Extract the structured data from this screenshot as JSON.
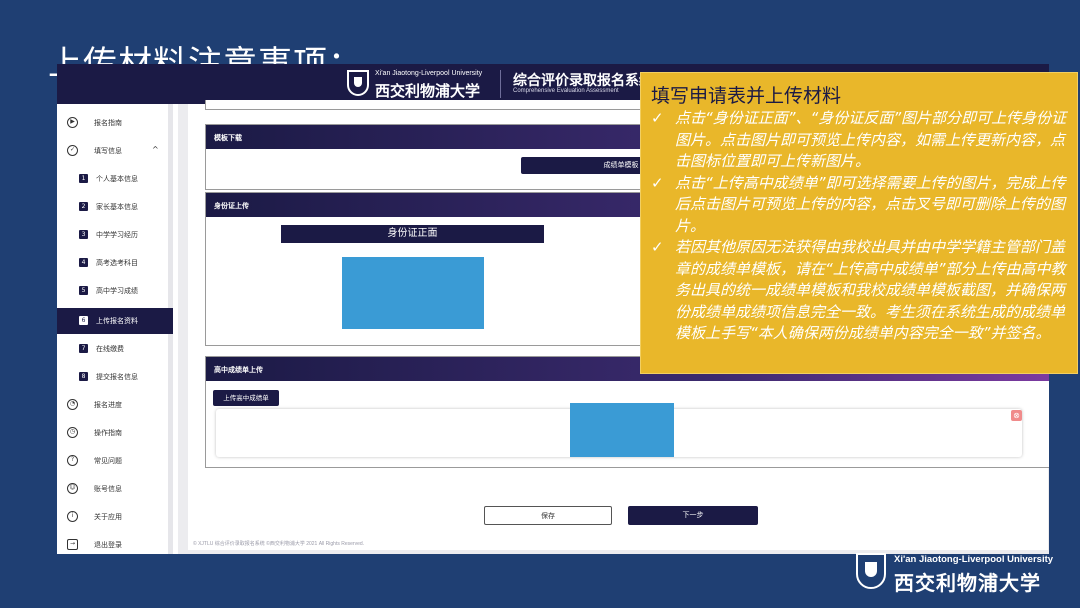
{
  "slide": {
    "title": "上传材料注意事项："
  },
  "header": {
    "logo_en": "Xi'an Jiaotong-Liverpool University",
    "logo_cn": "西交利物浦大学",
    "system_title": "综合评价录取报名系统",
    "system_subtitle": "Comprehensive Evaluation Assessment"
  },
  "sidebar": {
    "items": [
      {
        "label": "报名指南",
        "icon": "play-circle-icon"
      },
      {
        "label": "填写信息",
        "icon": "edit-circle-icon"
      },
      {
        "num": "1",
        "label": "个人基本信息"
      },
      {
        "num": "2",
        "label": "家长基本信息"
      },
      {
        "num": "3",
        "label": "中学学习经历"
      },
      {
        "num": "4",
        "label": "高考选考科目"
      },
      {
        "num": "5",
        "label": "高中学习成绩"
      },
      {
        "num": "6",
        "label": "上传报名资料"
      },
      {
        "num": "7",
        "label": "在线缴费"
      },
      {
        "num": "8",
        "label": "提交报名信息"
      },
      {
        "label": "报名进度",
        "icon": "gauge-icon"
      },
      {
        "label": "操作指南",
        "icon": "clock-icon"
      },
      {
        "label": "常见问题",
        "icon": "question-icon"
      },
      {
        "label": "账号信息",
        "icon": "user-icon"
      },
      {
        "label": "关于应用",
        "icon": "info-icon"
      },
      {
        "label": "退出登录",
        "icon": "logout-icon"
      }
    ]
  },
  "sections": {
    "template": {
      "title": "模板下载",
      "button": "成绩单模板"
    },
    "idcard": {
      "title": "身份证上传",
      "front_label": "身份证正面"
    },
    "transcript": {
      "title": "高中成绩单上传",
      "button": "上传高中成绩单"
    }
  },
  "footer": {
    "save": "保存",
    "next": "下一步",
    "copyright": "© XJTLU 综合评价录取报名系统 ©西交利物浦大学 2021 All Rights Reserved."
  },
  "note": {
    "title": "填写申请表并上传材料",
    "items": [
      "点击“身份证正面”、“身份证反面”图片部分即可上传身份证图片。点击图片即可预览上传内容，如需上传更新内容，点击图标位置即可上传新图片。",
      "点击“上传高中成绩单”即可选择需要上传的图片，完成上传后点击图片可预览上传的内容，点击叉号即可删除上传的图片。",
      "若因其他原因无法获得由我校出具并由中学学籍主管部门盖章的成绩单模板，请在“上传高中成绩单”部分上传由高中教务出具的统一成绩单模板和我校成绩单模板截图，并确保两份成绩单成绩项信息完全一致。考生须在系统生成的成绩单模板上手写“本人确保两份成绩单内容完全一致”并签名。"
    ]
  },
  "colors": {
    "background": "#1f3f73",
    "navy": "#1b1a45",
    "note_yellow": "#e9b72a",
    "image_blue": "#3a9bd5"
  }
}
